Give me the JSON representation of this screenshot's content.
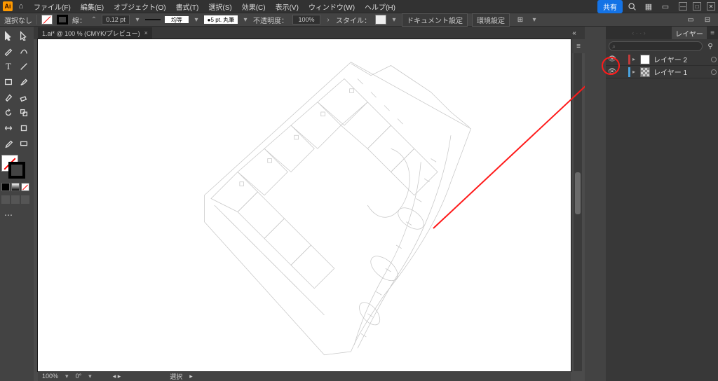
{
  "menu": {
    "items": [
      "ファイル(F)",
      "編集(E)",
      "オブジェクト(O)",
      "書式(T)",
      "選択(S)",
      "効果(C)",
      "表示(V)",
      "ウィンドウ(W)",
      "ヘルプ(H)"
    ],
    "share": "共有"
  },
  "ctrl": {
    "selection": "選択なし",
    "stroke_label": "線：",
    "stroke_weight": "0.12 pt",
    "dash_label": "均等",
    "brush_label": "5 pt. 丸筆",
    "opacity_label": "不透明度：",
    "opacity_value": "100%",
    "style_label": "スタイル：",
    "doc_setup": "ドキュメント設定",
    "prefs": "環境設定"
  },
  "doc": {
    "tab": "1.ai* @ 100 % (CMYK/プレビュー)"
  },
  "status": {
    "zoom": "100%",
    "rotate": "0°",
    "tool": "選択"
  },
  "layers": {
    "title": "レイヤー",
    "search_placeholder": "",
    "rows": [
      {
        "name": "レイヤー 2",
        "color": "#c23b3b",
        "thumb": "blank"
      },
      {
        "name": "レイヤー 1",
        "color": "#4aa3df",
        "thumb": "checker"
      }
    ]
  }
}
